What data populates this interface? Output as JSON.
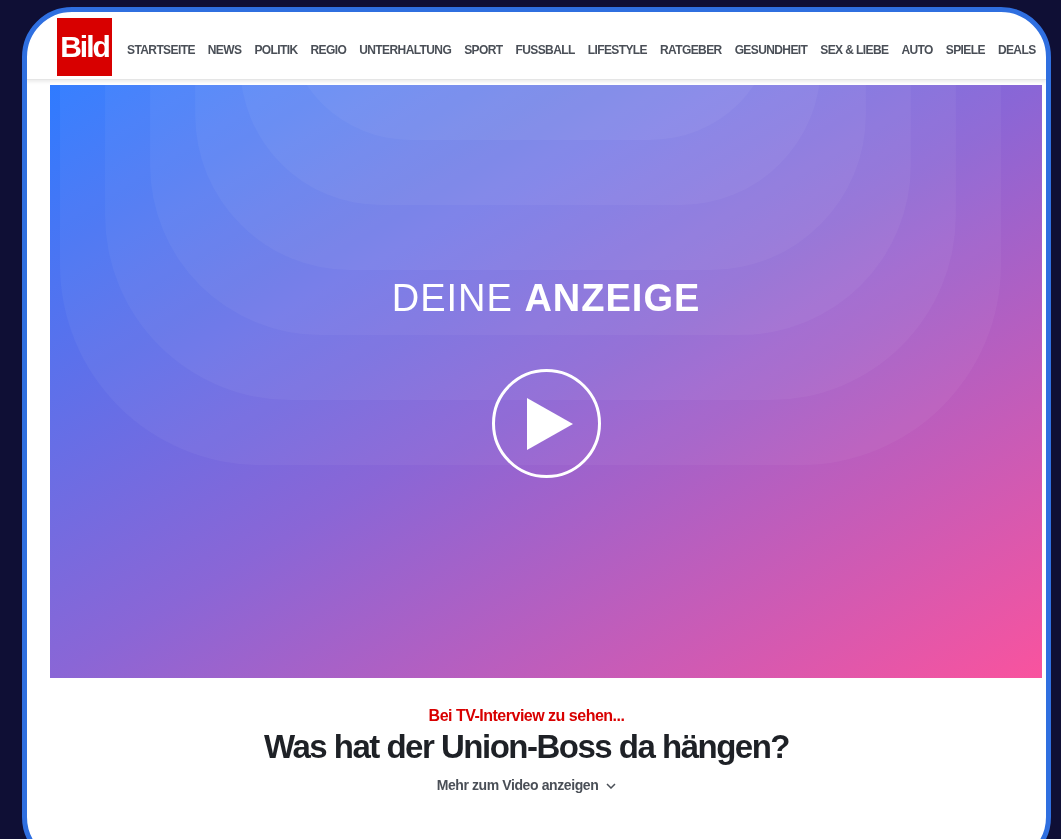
{
  "logo": {
    "text": "Bild"
  },
  "nav": [
    {
      "label": "STARTSEITE"
    },
    {
      "label": "NEWS"
    },
    {
      "label": "POLITIK"
    },
    {
      "label": "REGIO"
    },
    {
      "label": "UNTERHALTUNG"
    },
    {
      "label": "SPORT"
    },
    {
      "label": "FUSSBALL"
    },
    {
      "label": "LIFESTYLE"
    },
    {
      "label": "RATGEBER"
    },
    {
      "label": "GESUNDHEIT"
    },
    {
      "label": "SEX & LIEBE"
    },
    {
      "label": "AUTO"
    },
    {
      "label": "SPIELE"
    },
    {
      "label": "DEALS"
    }
  ],
  "video": {
    "kind": "picture",
    "overlay_text": "DEINE **ANZEIGE**"
  },
  "article": {
    "kicker": "Bei TV-Interview zu sehen...",
    "headline": "Was hat der Union-Boss da hängen?",
    "more_link": "Mehr zum Video anzeigen"
  }
}
